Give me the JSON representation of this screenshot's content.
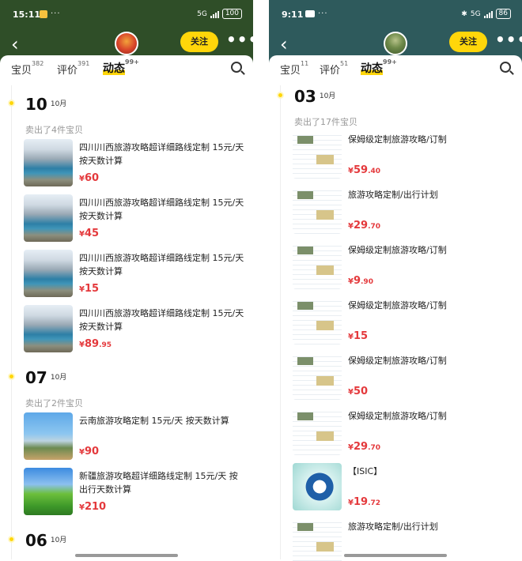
{
  "left": {
    "status": {
      "time": "15:11",
      "battery": "100",
      "network": "5G"
    },
    "nav": {
      "back": "‹",
      "follow": "关注",
      "more": "•••"
    },
    "tabs": [
      {
        "label": "宝贝",
        "count": "382"
      },
      {
        "label": "评价",
        "count": "391"
      },
      {
        "label": "动态",
        "count": "99+"
      }
    ],
    "groups": [
      {
        "day": "10",
        "month": "10月",
        "sold": "卖出了4件宝贝",
        "items": [
          {
            "title": "四川川西旅游攻略超详细路线定制 15元/天 按天数计算",
            "currency": "¥",
            "int": "60",
            "dec": "",
            "thumb": "lake"
          },
          {
            "title": "四川川西旅游攻略超详细路线定制 15元/天 按天数计算",
            "currency": "¥",
            "int": "45",
            "dec": "",
            "thumb": "lake"
          },
          {
            "title": "四川川西旅游攻略超详细路线定制 15元/天 按天数计算",
            "currency": "¥",
            "int": "15",
            "dec": "",
            "thumb": "lake"
          },
          {
            "title": "四川川西旅游攻略超详细路线定制 15元/天 按天数计算",
            "currency": "¥",
            "int": "89",
            "dec": ".95",
            "thumb": "lake"
          }
        ]
      },
      {
        "day": "07",
        "month": "10月",
        "sold": "卖出了2件宝贝",
        "items": [
          {
            "title": "云南旅游攻略定制 15元/天 按天数计算",
            "currency": "¥",
            "int": "90",
            "dec": "",
            "thumb": "tree"
          },
          {
            "title": "新疆旅游攻略超详细路线定制 15元/天 按出行天数计算",
            "currency": "¥",
            "int": "210",
            "dec": "",
            "thumb": "green"
          }
        ]
      },
      {
        "day": "06",
        "month": "10月"
      }
    ]
  },
  "right": {
    "status": {
      "time": "9:11",
      "battery": "86",
      "network": "5G"
    },
    "nav": {
      "back": "‹",
      "follow": "关注",
      "more": "•••"
    },
    "tabs": [
      {
        "label": "宝贝",
        "count": "11"
      },
      {
        "label": "评价",
        "count": "51"
      },
      {
        "label": "动态",
        "count": "99+"
      }
    ],
    "groups": [
      {
        "day": "03",
        "month": "10月",
        "sold": "卖出了17件宝贝",
        "items": [
          {
            "title": "保姆级定制旅游攻略/订制",
            "currency": "¥",
            "int": "59",
            "dec": ".40",
            "thumb": "doc"
          },
          {
            "title": "旅游攻略定制/出行计划",
            "currency": "¥",
            "int": "29",
            "dec": ".70",
            "thumb": "doc"
          },
          {
            "title": "保姆级定制旅游攻略/订制",
            "currency": "¥",
            "int": "9",
            "dec": ".90",
            "thumb": "doc"
          },
          {
            "title": "保姆级定制旅游攻略/订制",
            "currency": "¥",
            "int": "15",
            "dec": "",
            "thumb": "doc"
          },
          {
            "title": "保姆级定制旅游攻略/订制",
            "currency": "¥",
            "int": "50",
            "dec": "",
            "thumb": "doc"
          },
          {
            "title": "保姆级定制旅游攻略/订制",
            "currency": "¥",
            "int": "29",
            "dec": ".70",
            "thumb": "doc"
          },
          {
            "title": "【ISIC】",
            "currency": "¥",
            "int": "19",
            "dec": ".72",
            "thumb": "isic"
          },
          {
            "title": "旅游攻略定制/出行计划",
            "currency": "",
            "int": "",
            "dec": "",
            "thumb": "doc"
          }
        ]
      }
    ]
  }
}
